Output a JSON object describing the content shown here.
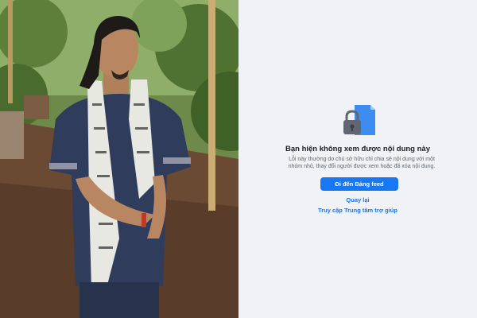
{
  "content_unavailable": {
    "heading": "Bạn hiện không xem được nội dung này",
    "description": "Lỗi này thường do chủ sở hữu chỉ chia sẻ nội dung với một nhóm nhỏ, thay đổi người được xem hoặc đã xóa nội dung.",
    "primary_button": "Đi đến Bảng feed",
    "back_link": "Quay lại",
    "help_link": "Truy cập Trung tâm trợ giúp",
    "icon": "lock-icon"
  },
  "colors": {
    "panel_background": "#f0f2f5",
    "accent": "#1877f2",
    "heading_text": "#1c1e21",
    "body_text": "#606770"
  }
}
